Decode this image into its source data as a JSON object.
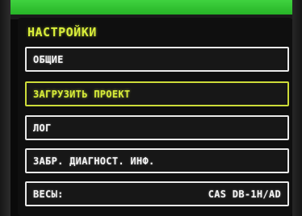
{
  "screen": {
    "title": "НАСТРОЙКИ",
    "items": [
      {
        "label": "ОБЩИЕ"
      },
      {
        "label": "ЗАГРУЗИТЬ ПРОЕКТ",
        "selected": true
      },
      {
        "label": "ЛОГ"
      },
      {
        "label": "ЗАБР. ДИАГНОСТ. ИНФ."
      },
      {
        "label": "ВЕСЫ:",
        "value": "CAS DB-1H/AD"
      }
    ]
  },
  "colors": {
    "accent": "#d9ee3a",
    "bezel_top": "#2fc42f",
    "item_border": "#e9e9e9",
    "background": "#0f0f0f"
  }
}
